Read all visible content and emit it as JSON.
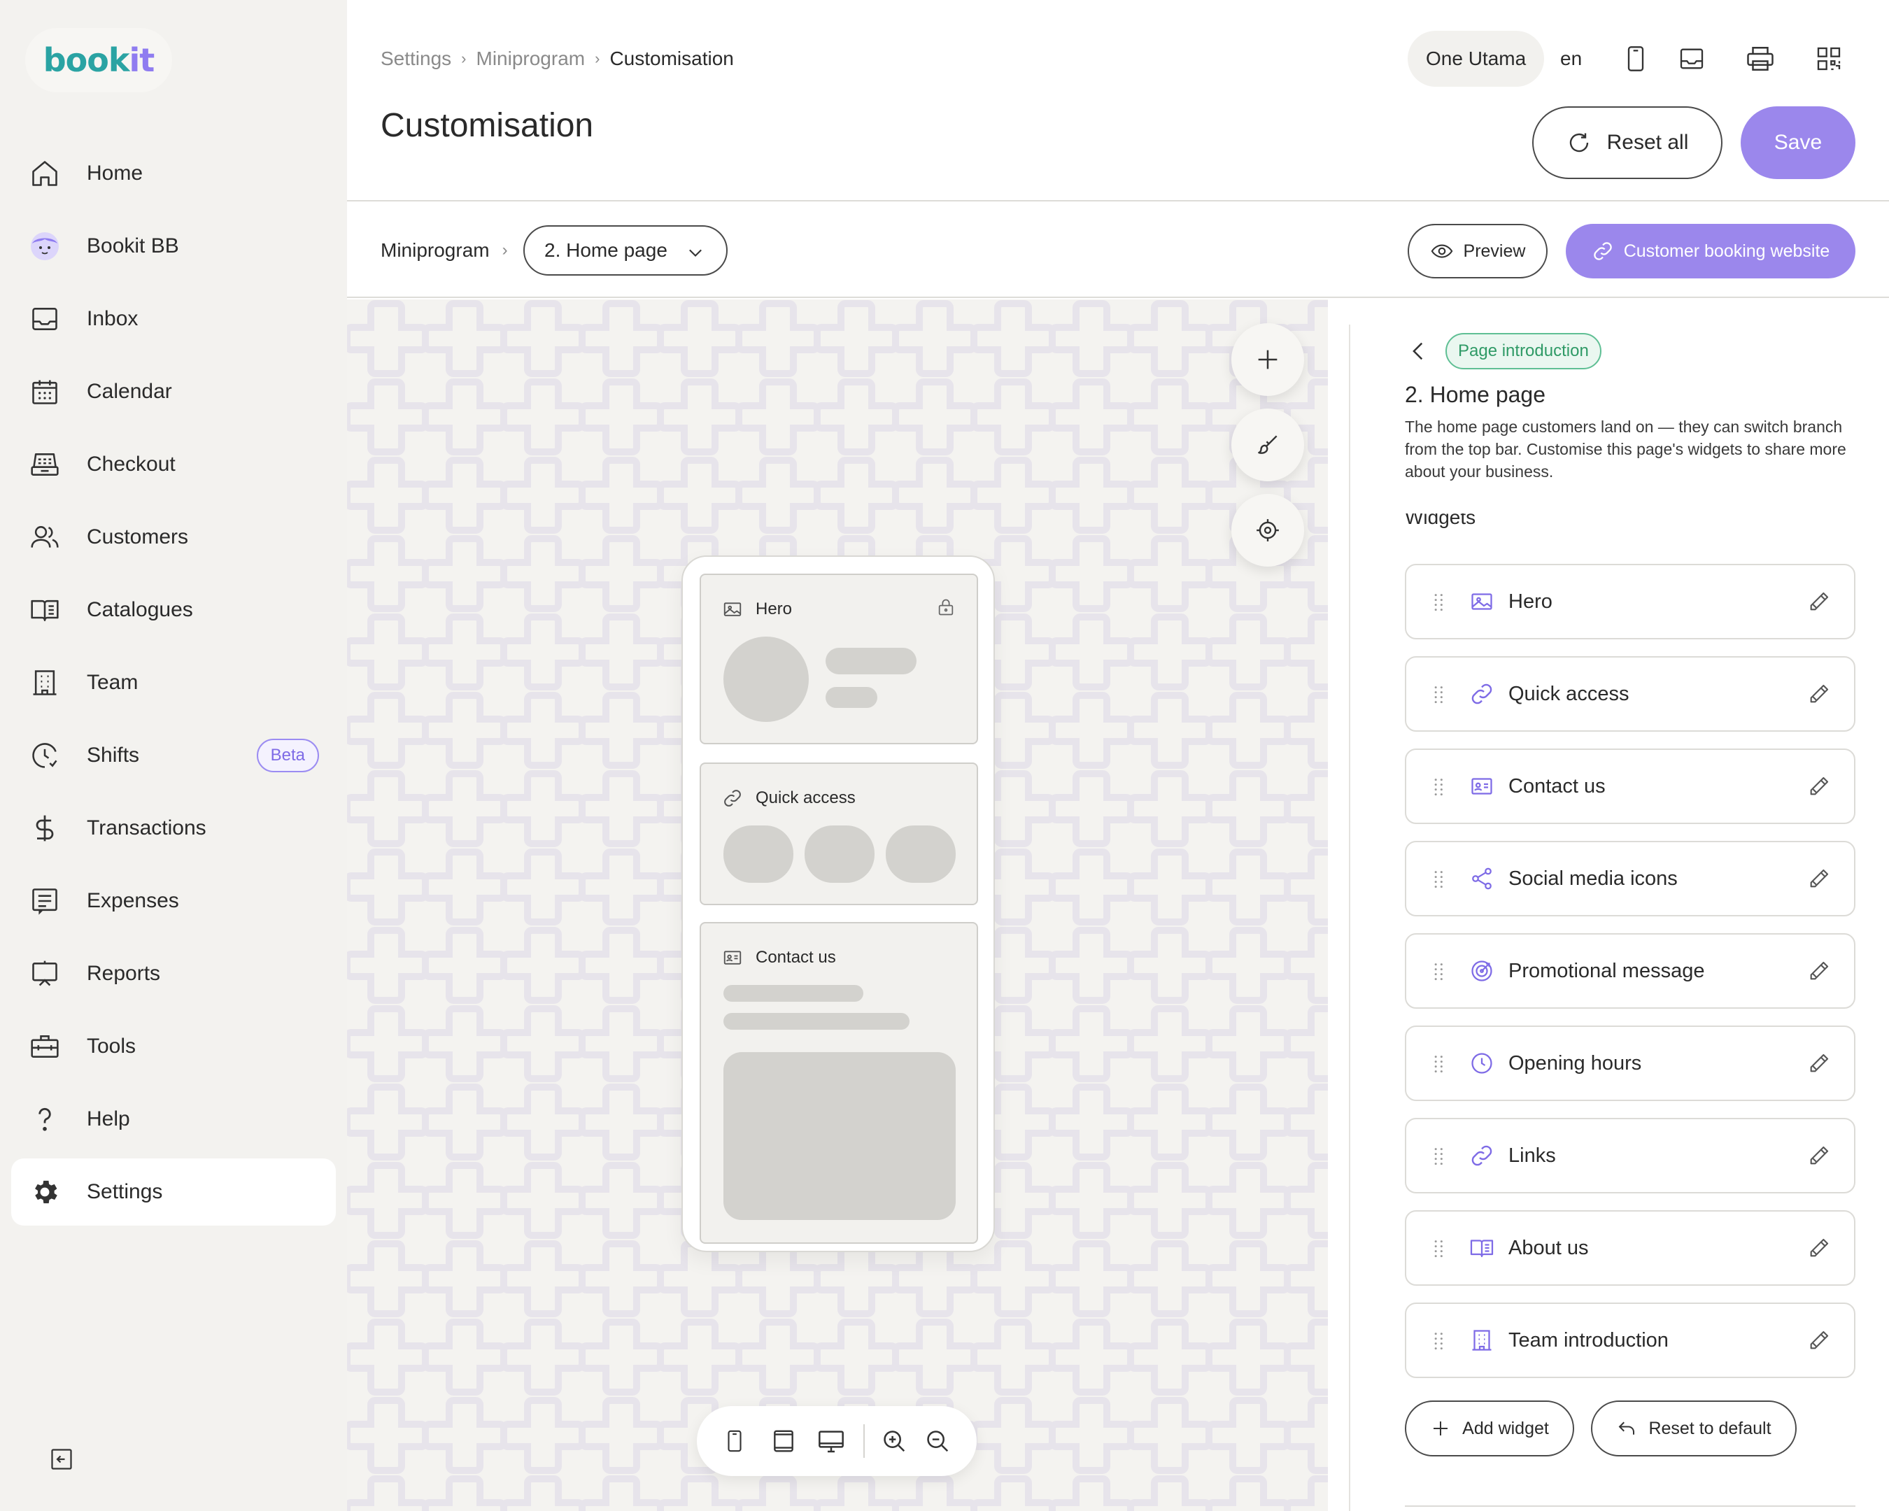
{
  "brand": {
    "logo_part1": "book",
    "logo_part2": "it"
  },
  "sidebar": {
    "items": [
      {
        "label": "Home",
        "icon": "home-icon"
      },
      {
        "label": "Bookit BB",
        "icon": "assistant-avatar-icon"
      },
      {
        "label": "Inbox",
        "icon": "inbox-icon"
      },
      {
        "label": "Calendar",
        "icon": "calendar-icon"
      },
      {
        "label": "Checkout",
        "icon": "cash-register-icon"
      },
      {
        "label": "Customers",
        "icon": "users-icon"
      },
      {
        "label": "Catalogues",
        "icon": "book-icon"
      },
      {
        "label": "Team",
        "icon": "building-icon"
      },
      {
        "label": "Shifts",
        "icon": "clock-icon",
        "badge": "Beta"
      },
      {
        "label": "Transactions",
        "icon": "dollar-icon"
      },
      {
        "label": "Expenses",
        "icon": "receipt-icon"
      },
      {
        "label": "Reports",
        "icon": "presentation-icon"
      },
      {
        "label": "Tools",
        "icon": "toolbox-icon"
      },
      {
        "label": "Help",
        "icon": "question-icon"
      },
      {
        "label": "Settings",
        "icon": "gear-icon",
        "active": true
      }
    ]
  },
  "header": {
    "breadcrumb": [
      "Settings",
      "Miniprogram",
      "Customisation"
    ],
    "title": "Customisation",
    "branch": "One Utama",
    "lang": "en",
    "reset_label": "Reset all",
    "save_label": "Save"
  },
  "toolbar": {
    "crumb": "Miniprogram",
    "page_select": "2. Home page",
    "preview_label": "Preview",
    "site_label": "Customer booking website"
  },
  "preview": {
    "cards": [
      {
        "label": "Hero",
        "icon": "image-icon"
      },
      {
        "label": "Quick access",
        "icon": "link-icon"
      },
      {
        "label": "Contact us",
        "icon": "contact-card-icon"
      }
    ]
  },
  "panel": {
    "tag": "Page introduction",
    "title": "2. Home page",
    "description": "The home page customers land on — they can switch branch from the top bar. Customise this page's widgets to share more about your business.",
    "section": "Widgets",
    "widgets": [
      {
        "label": "Hero",
        "icon": "image-icon"
      },
      {
        "label": "Quick access",
        "icon": "link-icon"
      },
      {
        "label": "Contact us",
        "icon": "contact-card-icon"
      },
      {
        "label": "Social media icons",
        "icon": "share-icon"
      },
      {
        "label": "Promotional message",
        "icon": "target-icon"
      },
      {
        "label": "Opening hours",
        "icon": "clock-icon"
      },
      {
        "label": "Links",
        "icon": "link-icon"
      },
      {
        "label": "About us",
        "icon": "book-icon"
      },
      {
        "label": "Team introduction",
        "icon": "building-icon"
      }
    ],
    "add_label": "Add widget",
    "reset_default_label": "Reset to default"
  },
  "colors": {
    "accent": "#9b87ec",
    "accent_icon": "#7e6be6",
    "tag_green": "#2f9a66"
  }
}
